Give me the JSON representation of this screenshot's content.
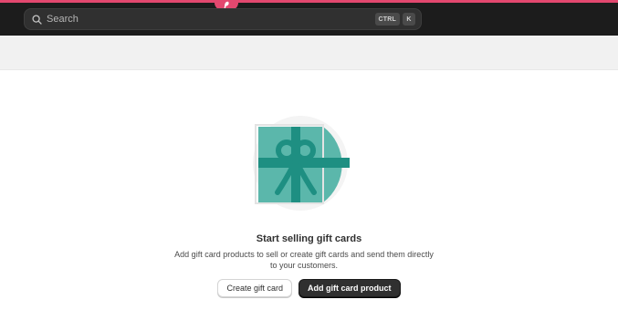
{
  "topbar": {
    "search_placeholder": "Search",
    "shortcut_modifier": "CTRL",
    "shortcut_key": "K",
    "accent_color": "#e3486f",
    "background_color": "#1c1c1c"
  },
  "empty_state": {
    "illustration_icon": "gift-card-icon",
    "heading": "Start selling gift cards",
    "description": "Add gift card products to sell or create gift cards and send them directly to your customers.",
    "secondary_action": "Create gift card",
    "primary_action": "Add gift card product",
    "card_color": "#5bb7ab",
    "ribbon_color": "#1e8f82"
  }
}
